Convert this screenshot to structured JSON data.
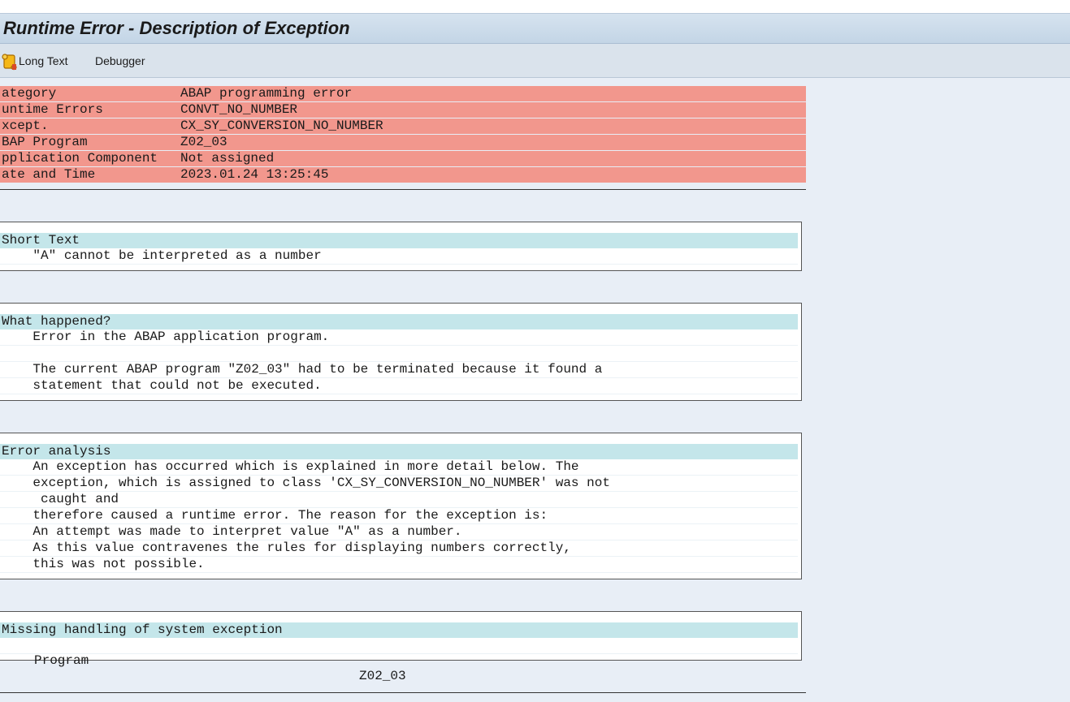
{
  "window": {
    "title": "Runtime Error - Description of Exception"
  },
  "toolbar": {
    "long_text_label": "Long Text",
    "debugger_label": "Debugger"
  },
  "header_info": [
    {
      "key": "ategory",
      "value": "ABAP programming error"
    },
    {
      "key": "untime Errors",
      "value": "CONVT_NO_NUMBER"
    },
    {
      "key": "xcept.",
      "value": "CX_SY_CONVERSION_NO_NUMBER"
    },
    {
      "key": "BAP Program",
      "value": "Z02_03"
    },
    {
      "key": "pplication Component",
      "value": "Not assigned"
    },
    {
      "key": "ate and Time",
      "value": "2023.01.24 13:25:45"
    }
  ],
  "short_text": {
    "title": "Short Text",
    "lines": [
      "    \"A\" cannot be interpreted as a number"
    ]
  },
  "what_happened": {
    "title": "What happened?",
    "lines": [
      "    Error in the ABAP application program.",
      "",
      "    The current ABAP program \"Z02_03\" had to be terminated because it found a",
      "    statement that could not be executed."
    ]
  },
  "error_analysis": {
    "title": "Error analysis",
    "lines": [
      "    An exception has occurred which is explained in more detail below. The",
      "    exception, which is assigned to class 'CX_SY_CONVERSION_NO_NUMBER' was not",
      "     caught and",
      "    therefore caused a runtime error. The reason for the exception is:",
      "    An attempt was made to interpret value \"A\" as a number.",
      "    As this value contravenes the rules for displaying numbers correctly,",
      "    this was not possible."
    ]
  },
  "missing_handling": {
    "title": "Missing handling of system exception",
    "program_label": "Program",
    "program_value": "Z02_03"
  },
  "colors": {
    "header_bg": "#f2978d",
    "section_title_bg": "#c4e6ea",
    "page_bg": "#e8eef6"
  },
  "icons": {
    "long_text": "scroll-icon"
  }
}
